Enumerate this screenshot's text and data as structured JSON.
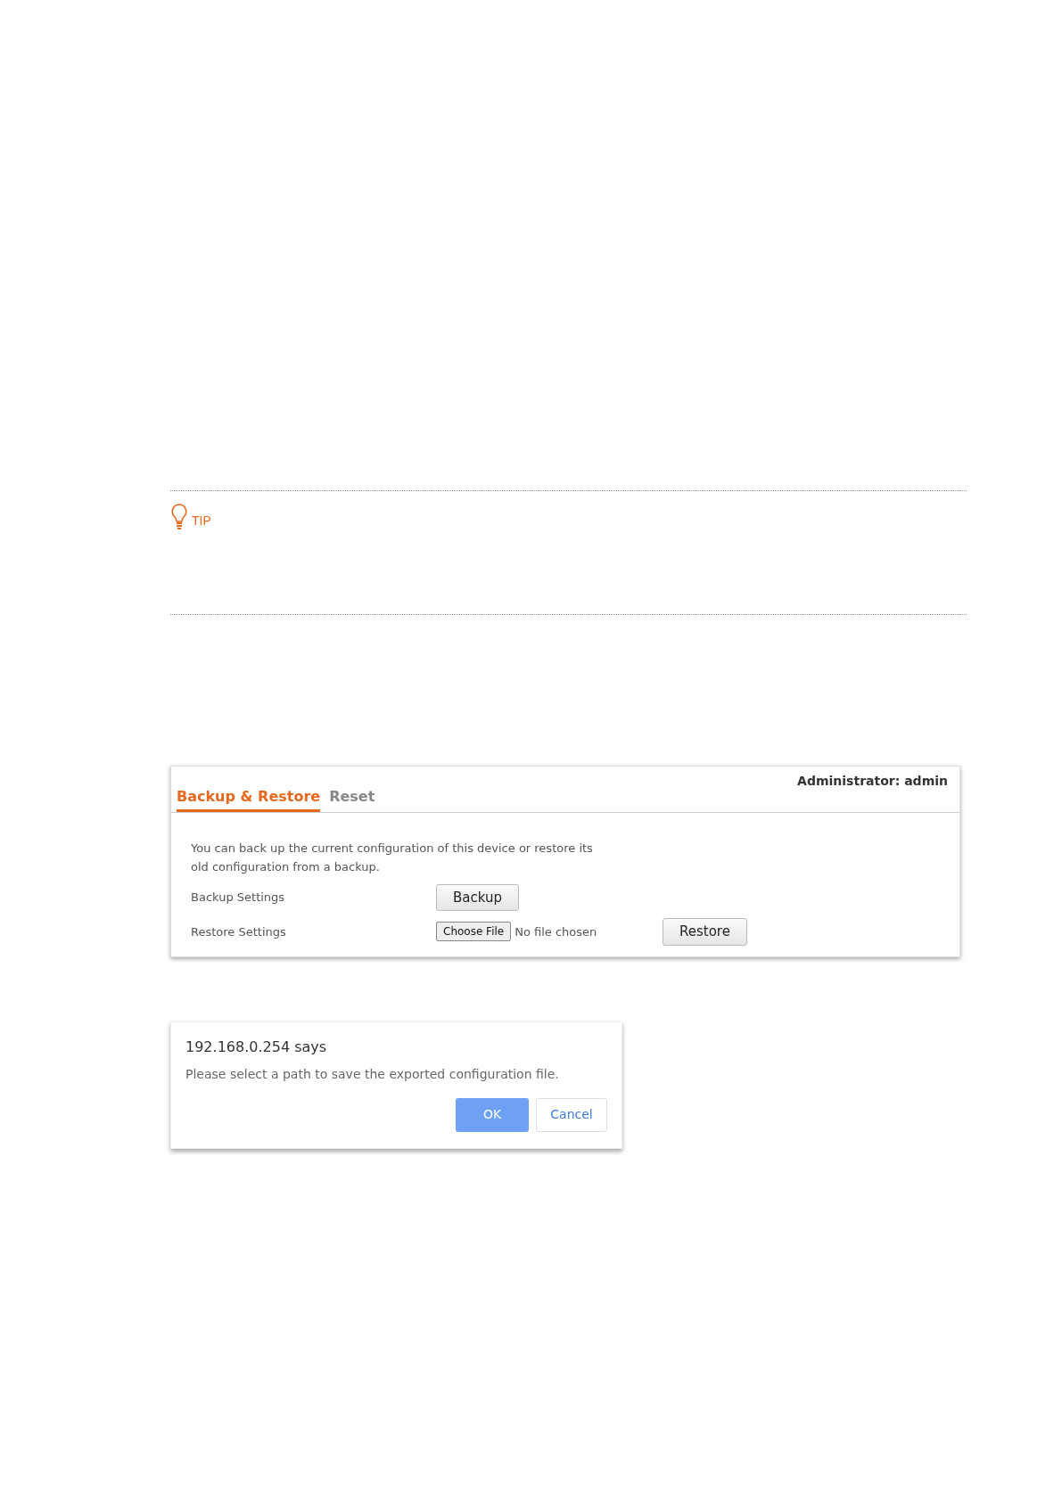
{
  "tip": {
    "label": "TIP"
  },
  "panel": {
    "user": "Administrator: admin",
    "tabs": [
      {
        "label": "Backup & Restore",
        "selected": true
      },
      {
        "label": "Reset",
        "selected": false
      }
    ],
    "description": "You can back up the current configuration of this device or restore its old configuration from a backup.",
    "rows": [
      {
        "kind": "button",
        "label": "Backup Settings",
        "button": "Backup"
      },
      {
        "kind": "file",
        "label": "Restore Settings",
        "file_button": "Choose File",
        "file_status": "No file chosen",
        "button": "Restore"
      }
    ]
  },
  "dialog": {
    "title": "192.168.0.254 says",
    "message": "Please select a path to save the exported configuration file.",
    "buttons": [
      {
        "label": "OK",
        "kind": "primary"
      },
      {
        "label": "Cancel",
        "kind": "secondary"
      }
    ]
  }
}
